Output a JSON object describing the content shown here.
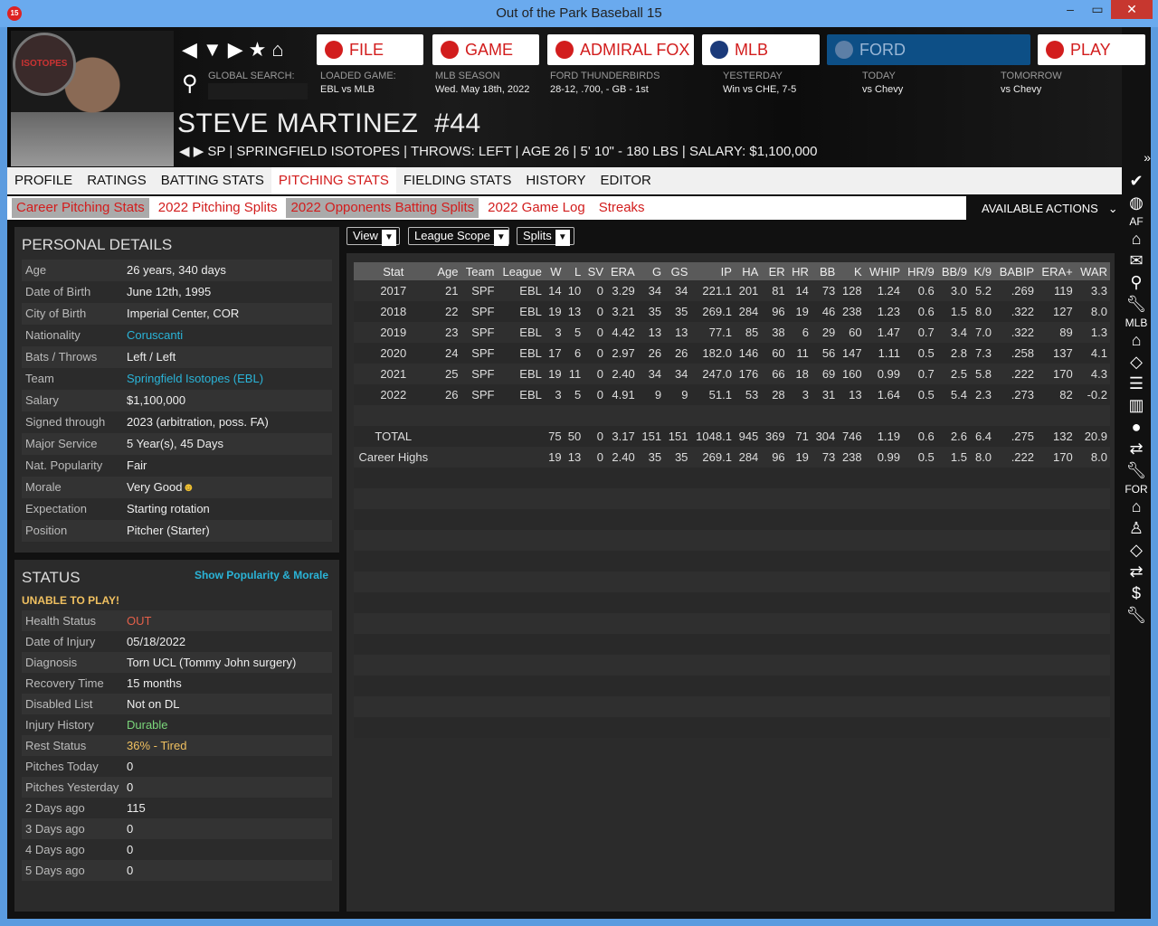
{
  "window": {
    "title": "Out of the Park Baseball 15",
    "icon": "15"
  },
  "top_buttons": [
    {
      "label": "FILE"
    },
    {
      "label": "GAME"
    },
    {
      "label": "ADMIRAL FOX"
    },
    {
      "label": "MLB"
    },
    {
      "label": "FORD"
    },
    {
      "label": "PLAY"
    }
  ],
  "info": {
    "search_label": "GLOBAL SEARCH:",
    "loaded_label": "LOADED GAME:",
    "loaded": "EBL vs MLB",
    "season_label": "MLB SEASON",
    "season": "Wed. May 18th, 2022",
    "team_label": "FORD THUNDERBIRDS",
    "team": "28-12, .700, - GB - 1st",
    "yesterday_label": "YESTERDAY",
    "yesterday": "Win vs CHE, 7-5",
    "today_label": "TODAY",
    "today": "vs Chevy",
    "tomorrow_label": "TOMORROW",
    "tomorrow": "vs Chevy"
  },
  "player": {
    "name": "STEVE MARTINEZ  #44",
    "subtitle": "SP | SPRINGFIELD ISOTOPES | THROWS: LEFT | AGE 26 | 5' 10\" - 180 LBS | SALARY: $1,100,000",
    "logo": "ISOTOPES"
  },
  "tabs": [
    "PROFILE",
    "RATINGS",
    "BATTING STATS",
    "PITCHING STATS",
    "FIELDING STATS",
    "HISTORY",
    "EDITOR"
  ],
  "subtabs": [
    "Career Pitching Stats",
    "2022 Pitching Splits",
    "2022 Opponents Batting Splits",
    "2022 Game Log",
    "Streaks"
  ],
  "available_actions": "AVAILABLE ACTIONS",
  "personal": {
    "title": "PERSONAL DETAILS",
    "rows": [
      [
        "Age",
        "26 years, 340 days"
      ],
      [
        "Date of Birth",
        "June 12th, 1995"
      ],
      [
        "City of Birth",
        "Imperial Center, COR"
      ],
      [
        "Nationality",
        "Coruscanti"
      ],
      [
        "Bats / Throws",
        "Left / Left"
      ],
      [
        "Team",
        "Springfield Isotopes (EBL)"
      ],
      [
        "Salary",
        "$1,100,000"
      ],
      [
        "Signed through",
        "2023 (arbitration, poss. FA)"
      ],
      [
        "Major Service",
        "5 Year(s), 45 Days"
      ],
      [
        "Nat. Popularity",
        "Fair"
      ],
      [
        "Morale",
        "Very Good"
      ],
      [
        "Expectation",
        "Starting rotation"
      ],
      [
        "Position",
        "Pitcher (Starter)"
      ]
    ]
  },
  "status": {
    "title": "STATUS",
    "link": "Show Popularity & Morale",
    "warning": "UNABLE TO PLAY!",
    "rows": [
      [
        "Health Status",
        "OUT"
      ],
      [
        "Date of Injury",
        "05/18/2022"
      ],
      [
        "Diagnosis",
        "Torn UCL (Tommy John surgery)"
      ],
      [
        "Recovery Time",
        "15 months"
      ],
      [
        "Disabled List",
        "Not on DL"
      ],
      [
        "Injury History",
        "Durable"
      ],
      [
        "Rest Status",
        "36% - Tired"
      ],
      [
        "Pitches Today",
        "0"
      ],
      [
        "Pitches Yesterday",
        "0"
      ],
      [
        "2 Days ago",
        "115"
      ],
      [
        "3 Days ago",
        "0"
      ],
      [
        "4 Days ago",
        "0"
      ],
      [
        "5 Days ago",
        "0"
      ]
    ]
  },
  "dropdowns": [
    "View",
    "League Scope",
    "Splits"
  ],
  "table": {
    "columns": [
      "Stat",
      "Age",
      "Team",
      "League",
      "W",
      "L",
      "SV",
      "ERA",
      "G",
      "GS",
      "IP",
      "HA",
      "ER",
      "HR",
      "BB",
      "K",
      "WHIP",
      "HR/9",
      "BB/9",
      "K/9",
      "BABIP",
      "ERA+",
      "WAR"
    ],
    "rows": [
      [
        "2017",
        "21",
        "SPF",
        "EBL",
        "14",
        "10",
        "0",
        "3.29",
        "34",
        "34",
        "221.1",
        "201",
        "81",
        "14",
        "73",
        "128",
        "1.24",
        "0.6",
        "3.0",
        "5.2",
        ".269",
        "119",
        "3.3"
      ],
      [
        "2018",
        "22",
        "SPF",
        "EBL",
        "19",
        "13",
        "0",
        "3.21",
        "35",
        "35",
        "269.1",
        "284",
        "96",
        "19",
        "46",
        "238",
        "1.23",
        "0.6",
        "1.5",
        "8.0",
        ".322",
        "127",
        "8.0"
      ],
      [
        "2019",
        "23",
        "SPF",
        "EBL",
        "3",
        "5",
        "0",
        "4.42",
        "13",
        "13",
        "77.1",
        "85",
        "38",
        "6",
        "29",
        "60",
        "1.47",
        "0.7",
        "3.4",
        "7.0",
        ".322",
        "89",
        "1.3"
      ],
      [
        "2020",
        "24",
        "SPF",
        "EBL",
        "17",
        "6",
        "0",
        "2.97",
        "26",
        "26",
        "182.0",
        "146",
        "60",
        "11",
        "56",
        "147",
        "1.11",
        "0.5",
        "2.8",
        "7.3",
        ".258",
        "137",
        "4.1"
      ],
      [
        "2021",
        "25",
        "SPF",
        "EBL",
        "19",
        "11",
        "0",
        "2.40",
        "34",
        "34",
        "247.0",
        "176",
        "66",
        "18",
        "69",
        "160",
        "0.99",
        "0.7",
        "2.5",
        "5.8",
        ".222",
        "170",
        "4.3"
      ],
      [
        "2022",
        "26",
        "SPF",
        "EBL",
        "3",
        "5",
        "0",
        "4.91",
        "9",
        "9",
        "51.1",
        "53",
        "28",
        "3",
        "31",
        "13",
        "1.64",
        "0.5",
        "5.4",
        "2.3",
        ".273",
        "82",
        "-0.2"
      ],
      [
        "",
        "",
        "",
        "",
        "",
        "",
        "",
        "",
        "",
        "",
        "",
        "",
        "",
        "",
        "",
        "",
        "",
        "",
        "",
        "",
        "",
        "",
        ""
      ],
      [
        "TOTAL",
        "",
        "",
        "",
        "75",
        "50",
        "0",
        "3.17",
        "151",
        "151",
        "1048.1",
        "945",
        "369",
        "71",
        "304",
        "746",
        "1.19",
        "0.6",
        "2.6",
        "6.4",
        ".275",
        "132",
        "20.9"
      ],
      [
        "Career Highs",
        "",
        "",
        "",
        "19",
        "13",
        "0",
        "2.40",
        "35",
        "35",
        "269.1",
        "284",
        "96",
        "19",
        "73",
        "238",
        "0.99",
        "0.5",
        "1.5",
        "8.0",
        ".222",
        "170",
        "8.0"
      ]
    ]
  },
  "sidebar": {
    "af": "AF",
    "mlb": "MLB",
    "for": "FOR"
  }
}
